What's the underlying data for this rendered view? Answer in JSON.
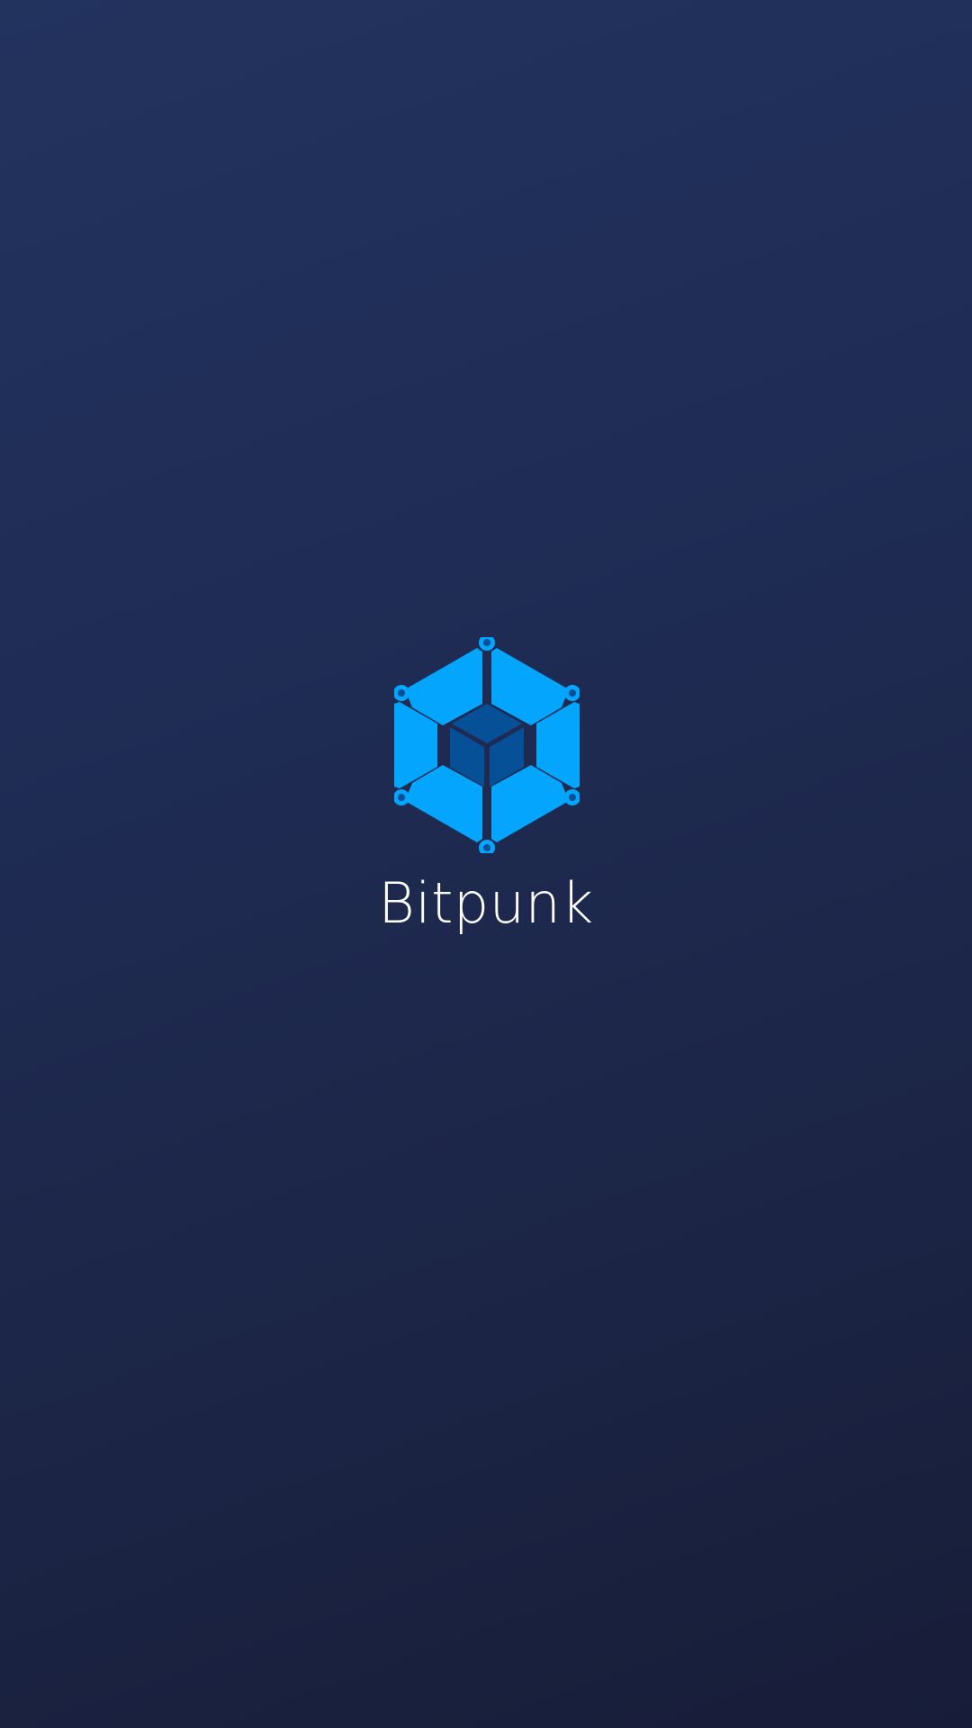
{
  "splash": {
    "app_name": "Bitpunk",
    "logo_icon": "hexagon-cube-icon",
    "colors": {
      "background_top": "#22335e",
      "background_bottom": "#171d38",
      "logo_outer": "#03a5fd",
      "logo_inner": "#055096",
      "text": "#ffffff"
    }
  }
}
